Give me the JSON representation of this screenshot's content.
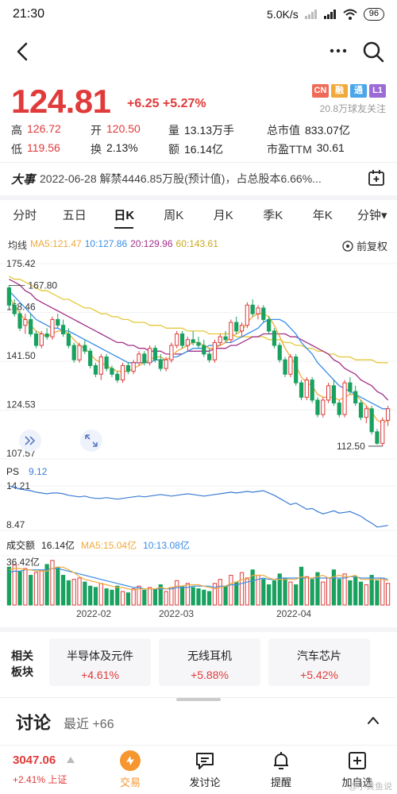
{
  "status_bar": {
    "time": "21:30",
    "network_speed": "5.0K/s",
    "battery": "96"
  },
  "quote": {
    "price": "124.81",
    "change": "+6.25 +5.27%",
    "tags": [
      {
        "label": "CN",
        "color": "#ef6b57"
      },
      {
        "label": "融",
        "color": "#f2a93b"
      },
      {
        "label": "通",
        "color": "#4aa6e8"
      },
      {
        "label": "L1",
        "color": "#9b6bd6"
      }
    ],
    "followers": "20.8万球友关注"
  },
  "stats": {
    "high_label": "高",
    "high": "126.72",
    "open_label": "开",
    "open": "120.50",
    "volume_label": "量",
    "volume": "13.13万手",
    "mktcap_label": "总市值",
    "mktcap": "833.07亿",
    "low_label": "低",
    "low": "119.56",
    "turnover_label": "换",
    "turnover": "2.13%",
    "amount_label": "额",
    "amount": "16.14亿",
    "pe_label": "市盈TTM",
    "pe": "30.61"
  },
  "event": {
    "label": "大事",
    "text": "2022-06-28 解禁4446.85万股(预计值)，占总股本6.66%..."
  },
  "tabs": [
    "分时",
    "五日",
    "日K",
    "周K",
    "月K",
    "季K",
    "年K",
    "分钟▾"
  ],
  "active_tab": "日K",
  "ma_legend": {
    "title": "均线",
    "ma5": "MA5:121.47",
    "ma10": "10:127.86",
    "ma20": "20:129.96",
    "ma60": "60:143.61",
    "adjust": "前复权"
  },
  "colors": {
    "up": "#e03a3a",
    "down": "#19a15f",
    "ma5": "#f2a93b",
    "ma10": "#3a8ee6",
    "ma20": "#a2308a",
    "ma60": "#e4c93b",
    "ps": "#3a7bd5"
  },
  "chart_data": [
    {
      "type": "candlestick",
      "title": "",
      "y_ticks": [
        "175.42",
        "158.46",
        "141.50",
        "124.53",
        "107.57"
      ],
      "ylim": [
        107.57,
        175.42
      ],
      "annotations": {
        "max": "167.80",
        "min": "112.50"
      },
      "candles": [
        [
          167,
          168,
          160,
          161
        ],
        [
          161,
          163,
          157,
          158
        ],
        [
          158,
          159,
          152,
          153
        ],
        [
          154,
          158,
          151,
          156
        ],
        [
          156,
          158,
          150,
          151
        ],
        [
          151,
          152,
          146,
          147
        ],
        [
          147,
          152,
          146,
          151
        ],
        [
          151,
          153,
          149,
          150
        ],
        [
          150,
          157,
          149,
          156
        ],
        [
          156,
          158,
          153,
          154
        ],
        [
          154,
          156,
          150,
          151
        ],
        [
          151,
          153,
          146,
          147
        ],
        [
          147,
          148,
          141,
          142
        ],
        [
          142,
          148,
          141,
          147
        ],
        [
          147,
          149,
          144,
          145
        ],
        [
          145,
          146,
          139,
          140
        ],
        [
          140,
          141,
          136,
          137
        ],
        [
          137,
          144,
          135,
          143
        ],
        [
          143,
          144,
          138,
          139
        ],
        [
          139,
          140,
          136,
          137
        ],
        [
          137,
          138,
          134,
          135
        ],
        [
          135,
          141,
          134,
          140
        ],
        [
          140,
          141,
          137,
          138
        ],
        [
          138,
          142,
          137,
          141
        ],
        [
          141,
          145,
          140,
          144
        ],
        [
          144,
          145,
          140,
          141
        ],
        [
          141,
          147,
          140,
          146
        ],
        [
          146,
          147,
          141,
          142
        ],
        [
          142,
          144,
          138,
          139
        ],
        [
          139,
          143,
          138,
          142
        ],
        [
          142,
          148,
          141,
          147
        ],
        [
          147,
          152,
          146,
          151
        ],
        [
          151,
          152,
          146,
          147
        ],
        [
          147,
          150,
          145,
          149
        ],
        [
          149,
          152,
          147,
          148
        ],
        [
          148,
          150,
          146,
          147
        ],
        [
          147,
          149,
          143,
          144
        ],
        [
          144,
          146,
          141,
          142
        ],
        [
          142,
          149,
          141,
          148
        ],
        [
          148,
          151,
          147,
          150
        ],
        [
          150,
          152,
          148,
          149
        ],
        [
          149,
          156,
          148,
          155
        ],
        [
          155,
          157,
          151,
          152
        ],
        [
          152,
          155,
          150,
          154
        ],
        [
          154,
          162,
          153,
          161
        ],
        [
          161,
          163,
          157,
          158
        ],
        [
          158,
          161,
          156,
          160
        ],
        [
          160,
          161,
          155,
          156
        ],
        [
          156,
          157,
          151,
          152
        ],
        [
          152,
          153,
          146,
          147
        ],
        [
          147,
          148,
          141,
          142
        ],
        [
          142,
          143,
          136,
          137
        ],
        [
          137,
          144,
          136,
          143
        ],
        [
          143,
          144,
          133,
          134
        ],
        [
          134,
          135,
          128,
          129
        ],
        [
          129,
          136,
          128,
          135
        ],
        [
          135,
          136,
          127,
          128
        ],
        [
          128,
          129,
          122,
          123
        ],
        [
          123,
          129,
          122,
          128
        ],
        [
          128,
          134,
          127,
          133
        ],
        [
          133,
          135,
          126,
          127
        ],
        [
          127,
          128,
          122,
          123
        ],
        [
          123,
          135,
          122,
          134
        ],
        [
          134,
          136,
          130,
          131
        ],
        [
          131,
          133,
          126,
          127
        ],
        [
          127,
          128,
          121,
          122
        ],
        [
          122,
          126,
          120,
          125
        ],
        [
          125,
          126,
          116,
          117
        ],
        [
          117,
          118,
          112.5,
          113
        ],
        [
          113,
          122,
          112,
          121
        ],
        [
          121,
          126,
          119,
          125
        ]
      ],
      "ma5": [
        164,
        161,
        158,
        156,
        154,
        152,
        151,
        150,
        151,
        152,
        152,
        151,
        149,
        147,
        146,
        144,
        142,
        141,
        140,
        139,
        138,
        138,
        138,
        139,
        140,
        141,
        142,
        143,
        143,
        142,
        143,
        145,
        146,
        147,
        148,
        148,
        147,
        146,
        146,
        147,
        148,
        150,
        151,
        152,
        155,
        157,
        158,
        158,
        157,
        154,
        150,
        146,
        143,
        140,
        136,
        134,
        133,
        130,
        129,
        129,
        129,
        128,
        129,
        130,
        130,
        128,
        126,
        124,
        121,
        120,
        121
      ],
      "ma10": [
        166,
        164,
        162,
        160,
        158,
        156,
        155,
        154,
        153,
        153,
        152,
        152,
        151,
        150,
        149,
        148,
        147,
        146,
        145,
        144,
        143,
        142,
        141,
        141,
        141,
        141,
        141,
        142,
        142,
        142,
        143,
        143,
        144,
        145,
        146,
        146,
        146,
        147,
        147,
        147,
        148,
        148,
        149,
        150,
        151,
        152,
        153,
        155,
        156,
        156,
        156,
        155,
        153,
        151,
        148,
        146,
        144,
        141,
        139,
        137,
        135,
        133,
        132,
        131,
        130,
        129,
        128,
        127,
        126,
        125,
        125
      ],
      "ma20": [
        170,
        169,
        168,
        166,
        165,
        163,
        162,
        161,
        160,
        159,
        158,
        157,
        156,
        155,
        154,
        153,
        152,
        151,
        150,
        149,
        148,
        148,
        147,
        147,
        146,
        146,
        145,
        145,
        145,
        144,
        144,
        144,
        144,
        145,
        145,
        145,
        145,
        145,
        146,
        146,
        146,
        147,
        147,
        148,
        149,
        150,
        150,
        151,
        151,
        151,
        151,
        151,
        150,
        150,
        149,
        148,
        147,
        146,
        145,
        144,
        142,
        141,
        139,
        138,
        137,
        135,
        134,
        133,
        131,
        130,
        128
      ],
      "ma60": [
        171,
        170,
        170,
        169,
        168,
        167,
        166,
        166,
        165,
        164,
        163,
        163,
        162,
        161,
        160,
        160,
        159,
        158,
        158,
        157,
        157,
        156,
        156,
        155,
        155,
        155,
        154,
        154,
        154,
        153,
        153,
        153,
        153,
        152,
        152,
        152,
        152,
        151,
        151,
        151,
        151,
        151,
        150,
        150,
        150,
        150,
        150,
        150,
        149,
        149,
        149,
        148,
        148,
        147,
        147,
        146,
        146,
        145,
        145,
        144,
        144,
        143,
        143,
        143,
        142,
        142,
        142,
        142,
        141,
        141,
        141
      ]
    },
    {
      "type": "line",
      "title": "",
      "series_name": "PS",
      "latest": "9.12",
      "y_ticks": [
        "14.21",
        "8.47"
      ],
      "ylim": [
        8.47,
        14.21
      ],
      "values": [
        14.2,
        14.0,
        13.8,
        13.7,
        13.6,
        13.4,
        13.3,
        13.2,
        13.3,
        13.3,
        13.2,
        13.0,
        12.9,
        12.8,
        12.9,
        12.7,
        12.6,
        12.6,
        12.7,
        12.6,
        12.5,
        12.6,
        12.7,
        12.8,
        12.9,
        12.8,
        12.9,
        13.0,
        13.1,
        13.0,
        12.9,
        13.0,
        13.1,
        13.2,
        13.1,
        13.0,
        12.9,
        13.0,
        13.1,
        13.2,
        13.3,
        13.4,
        13.3,
        13.4,
        13.5,
        13.4,
        13.5,
        13.6,
        13.3,
        13.0,
        12.6,
        12.2,
        11.8,
        12.0,
        11.6,
        11.2,
        11.3,
        10.9,
        10.6,
        10.8,
        11.0,
        10.7,
        10.8,
        10.9,
        10.6,
        10.3,
        9.8,
        9.4,
        8.9,
        9.0,
        9.12
      ]
    },
    {
      "type": "bar",
      "title": "",
      "series_name": "成交额",
      "latest": "16.14亿",
      "ma5_label": "MA5:15.04亿",
      "ma10_label": "10:13.08亿",
      "y_ticks": [
        "36.42亿"
      ],
      "ylim": [
        0,
        36.42
      ],
      "values": [
        28,
        30,
        25,
        27,
        22,
        24,
        26,
        30,
        33,
        28,
        22,
        18,
        19,
        20,
        17,
        14,
        13,
        16,
        12,
        11,
        14,
        10,
        9,
        12,
        14,
        11,
        13,
        12,
        15,
        10,
        13,
        18,
        14,
        16,
        13,
        12,
        11,
        10,
        16,
        19,
        14,
        22,
        17,
        24,
        20,
        26,
        22,
        19,
        15,
        18,
        23,
        20,
        17,
        15,
        28,
        21,
        19,
        24,
        17,
        20,
        26,
        19,
        23,
        18,
        21,
        17,
        15,
        22,
        18,
        20,
        16
      ],
      "ma5": [
        26,
        27,
        27,
        26,
        26,
        25,
        25,
        25,
        27,
        28,
        28,
        26,
        24,
        21,
        19,
        18,
        17,
        16,
        15,
        14,
        13,
        13,
        12,
        11,
        12,
        12,
        12,
        12,
        13,
        12,
        13,
        14,
        14,
        15,
        15,
        15,
        14,
        13,
        12,
        13,
        14,
        16,
        17,
        19,
        19,
        22,
        22,
        22,
        20,
        19,
        19,
        19,
        19,
        19,
        21,
        20,
        20,
        21,
        22,
        20,
        21,
        22,
        21,
        21,
        22,
        19,
        19,
        19,
        19,
        19,
        18
      ],
      "ma10": [
        24,
        25,
        25,
        26,
        26,
        26,
        26,
        26,
        27,
        27,
        26,
        25,
        24,
        23,
        22,
        21,
        20,
        19,
        18,
        17,
        16,
        15,
        14,
        13,
        13,
        12,
        12,
        12,
        12,
        12,
        12,
        13,
        13,
        13,
        14,
        14,
        14,
        14,
        13,
        14,
        14,
        15,
        15,
        16,
        17,
        18,
        19,
        20,
        19,
        19,
        20,
        20,
        20,
        20,
        20,
        20,
        20,
        20,
        20,
        20,
        20,
        20,
        20,
        21,
        21,
        20,
        20,
        20,
        20,
        20,
        19
      ],
      "up_flags": [
        0,
        1,
        0,
        1,
        0,
        1,
        1,
        0,
        1,
        0,
        0,
        0,
        1,
        1,
        0,
        0,
        0,
        1,
        0,
        0,
        0,
        1,
        0,
        1,
        1,
        0,
        1,
        0,
        0,
        1,
        1,
        1,
        0,
        1,
        0,
        0,
        0,
        0,
        1,
        1,
        0,
        1,
        0,
        1,
        1,
        0,
        1,
        0,
        0,
        0,
        0,
        0,
        1,
        0,
        0,
        1,
        0,
        0,
        1,
        1,
        0,
        0,
        1,
        0,
        0,
        0,
        1,
        0,
        0,
        1,
        1
      ]
    }
  ],
  "date_axis": [
    "2022-02",
    "2022-03",
    "2022-04"
  ],
  "sectors": {
    "title": "相关板块",
    "items": [
      {
        "name": "半导体及元件",
        "change": "+4.61%"
      },
      {
        "name": "无线耳机",
        "change": "+5.88%"
      },
      {
        "name": "汽车芯片",
        "change": "+5.42%"
      }
    ]
  },
  "discussion": {
    "title": "讨论",
    "subtitle": "最近 +66"
  },
  "bottom": {
    "index_value": "3047.06",
    "index_change": "+2.41% 上证",
    "nav": [
      {
        "label": "交易",
        "icon": "trade-icon"
      },
      {
        "label": "发讨论",
        "icon": "comment-icon"
      },
      {
        "label": "提醒",
        "icon": "bell-icon"
      },
      {
        "label": "加自选",
        "icon": "add-watchlist-icon"
      }
    ],
    "watermark": "@小黄鱼说"
  }
}
